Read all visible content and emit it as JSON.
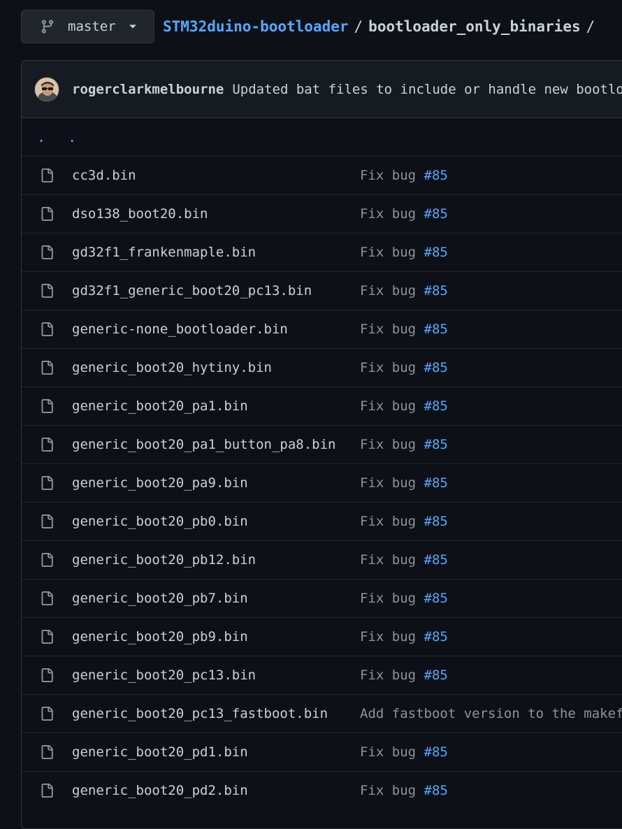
{
  "branch": {
    "name": "master"
  },
  "breadcrumb": {
    "repo": "STM32duino-bootloader",
    "sep1": "/",
    "dir": "bootloader_only_binaries",
    "sep2": "/"
  },
  "commit": {
    "author": "rogerclarkmelbourne",
    "message": "Updated bat files to include or handle new bootloaders"
  },
  "parent_dir": {
    "label": ". ."
  },
  "files": [
    {
      "name": "cc3d.bin",
      "msg": "Fix bug ",
      "issue": "#85"
    },
    {
      "name": "dso138_boot20.bin",
      "msg": "Fix bug ",
      "issue": "#85"
    },
    {
      "name": "gd32f1_frankenmaple.bin",
      "msg": "Fix bug ",
      "issue": "#85"
    },
    {
      "name": "gd32f1_generic_boot20_pc13.bin",
      "msg": "Fix bug ",
      "issue": "#85"
    },
    {
      "name": "generic-none_bootloader.bin",
      "msg": "Fix bug ",
      "issue": "#85"
    },
    {
      "name": "generic_boot20_hytiny.bin",
      "msg": "Fix bug ",
      "issue": "#85"
    },
    {
      "name": "generic_boot20_pa1.bin",
      "msg": "Fix bug ",
      "issue": "#85"
    },
    {
      "name": "generic_boot20_pa1_button_pa8.bin",
      "msg": "Fix bug ",
      "issue": "#85"
    },
    {
      "name": "generic_boot20_pa9.bin",
      "msg": "Fix bug ",
      "issue": "#85"
    },
    {
      "name": "generic_boot20_pb0.bin",
      "msg": "Fix bug ",
      "issue": "#85"
    },
    {
      "name": "generic_boot20_pb12.bin",
      "msg": "Fix bug ",
      "issue": "#85"
    },
    {
      "name": "generic_boot20_pb7.bin",
      "msg": "Fix bug ",
      "issue": "#85"
    },
    {
      "name": "generic_boot20_pb9.bin",
      "msg": "Fix bug ",
      "issue": "#85"
    },
    {
      "name": "generic_boot20_pc13.bin",
      "msg": "Fix bug ",
      "issue": "#85"
    },
    {
      "name": "generic_boot20_pc13_fastboot.bin",
      "msg": "Add fastboot version to the makefile",
      "issue": ""
    },
    {
      "name": "generic_boot20_pd1.bin",
      "msg": "Fix bug ",
      "issue": "#85"
    },
    {
      "name": "generic_boot20_pd2.bin",
      "msg": "Fix bug ",
      "issue": "#85"
    }
  ],
  "icons": {
    "branch": "git-branch-icon",
    "caret": "caret-down-icon",
    "file": "file-icon"
  },
  "colors": {
    "background": "#0d1117",
    "link": "#58a6ff",
    "muted": "#8b949e",
    "border": "#30363d"
  }
}
